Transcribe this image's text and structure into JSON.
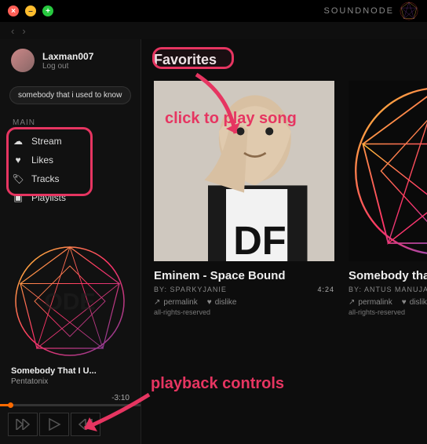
{
  "brand": "SOUNDNODE",
  "nav": {
    "back": "‹",
    "forward": "›"
  },
  "user": {
    "name": "Laxman007",
    "logout": "Log out"
  },
  "search": {
    "value": "somebody that i used to know"
  },
  "sidebar": {
    "section": "MAIN",
    "items": [
      {
        "label": "Stream",
        "icon": "☁"
      },
      {
        "label": "Likes",
        "icon": "♥"
      },
      {
        "label": "Tracks",
        "icon": "🏷"
      },
      {
        "label": "Playlists",
        "icon": "▣"
      }
    ]
  },
  "now_playing": {
    "title": "Somebody That I U...",
    "artist": "Pentatonix",
    "time": "-3:10"
  },
  "page": {
    "title": "Favorites"
  },
  "tracks": [
    {
      "title": "Eminem - Space Bound",
      "by_prefix": "BY: ",
      "by": "SPARKYJANIE",
      "duration": "4:24",
      "permalink": "permalink",
      "dislike": "dislike",
      "license": "all-rights-reserved"
    },
    {
      "title": "Somebody that I used to know - Gotye (",
      "by_prefix": "BY: ",
      "by": "ANTUS MANUJA",
      "duration": "",
      "permalink": "permalink",
      "dislike": "dislike",
      "license": "all-rights-reserved"
    }
  ],
  "annotations": {
    "click_to_play": "click to play song",
    "playback_controls": "playback controls"
  }
}
